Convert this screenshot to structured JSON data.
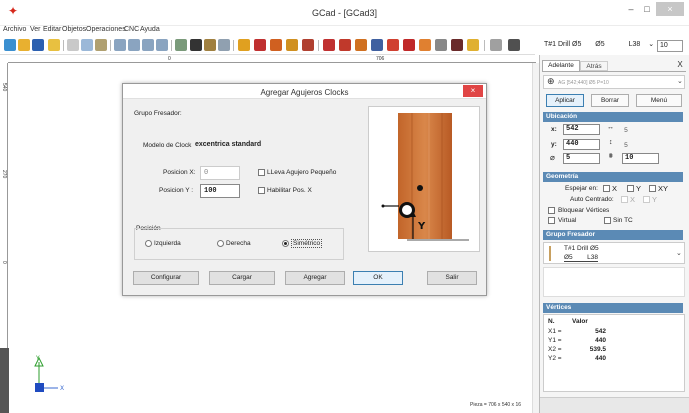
{
  "window": {
    "title": "GCad - [GCad3]",
    "min": "–",
    "max": "□",
    "close": "×"
  },
  "menu": [
    "Archivo",
    "Ver",
    "Editar",
    "Objetos",
    "Operaciones",
    "CNC",
    "Ayuda"
  ],
  "toolbar": {
    "tool_info": "T#1 Drill Ø5",
    "diam": "Ø5",
    "len": "L38",
    "zoom": "10"
  },
  "rulers": {
    "top_a": "0",
    "top_b": "706",
    "left_a": "540",
    "left_b": "270",
    "left_c": "0"
  },
  "status": "Pieza = 706 x 540 x 16",
  "axis": {
    "x": "X",
    "y": "Y"
  },
  "dialog": {
    "title": "Agregar Agujeros Clocks",
    "close": "×",
    "group": "Grupo Fresador:",
    "model_label": "Modelo de Clock",
    "model_value": "excentrica standard",
    "posx_label": "Posicion X:",
    "posx_value": "0",
    "posy_label": "Posicion Y :",
    "posy_value": "100",
    "chk_small": "LLeva Agujero Pequeño",
    "chk_posx": "Habilitar Pos. X",
    "position_label": "Posición",
    "radio_left": "Izquierda",
    "radio_right": "Derecha",
    "radio_sym": "Simétrico",
    "btn_config": "Configurar",
    "btn_load": "Cargar",
    "btn_add": "Agregar",
    "btn_ok": "OK",
    "btn_exit": "Salir",
    "preview_axis": "Y"
  },
  "panel": {
    "tab_fwd": "Adelante",
    "tab_back": "Atrás",
    "close": "X",
    "op_text": "AG [542;440] Ø5 P=10",
    "btn_apply": "Aplicar",
    "btn_delete": "Borrar",
    "btn_menu": "Menú",
    "sec_loc": "Ubicación",
    "x_label": "x:",
    "x_value": "542",
    "x_delta": "5",
    "y_label": "y:",
    "y_value": "440",
    "y_delta": "5",
    "d_label": "⌀",
    "d_value": "5",
    "depth_value": "10",
    "sec_geo": "Geometría",
    "mirror_label": "Espejar en:",
    "mirror_x": "X",
    "mirror_y": "Y",
    "mirror_xy": "XY",
    "autocenter_label": "Auto Centrado:",
    "ac_x": "X",
    "ac_y": "Y",
    "lock_vertices": "Bloquear Vértices",
    "virtual": "Virtual",
    "no_tc": "Sin TC",
    "sec_tool": "Grupo Fresador",
    "tool_line1": "T#1 Drill Ø5",
    "tool_line2": "Ø5        L38",
    "sec_vert": "Vértices",
    "vert_h_n": "N.",
    "vert_h_v": "Valor",
    "vertices": [
      {
        "n": "X1 =",
        "v": "542"
      },
      {
        "n": "Y1 =",
        "v": "440"
      },
      {
        "n": "X2 =",
        "v": "539.5"
      },
      {
        "n": "Y2 =",
        "v": "440"
      }
    ]
  }
}
